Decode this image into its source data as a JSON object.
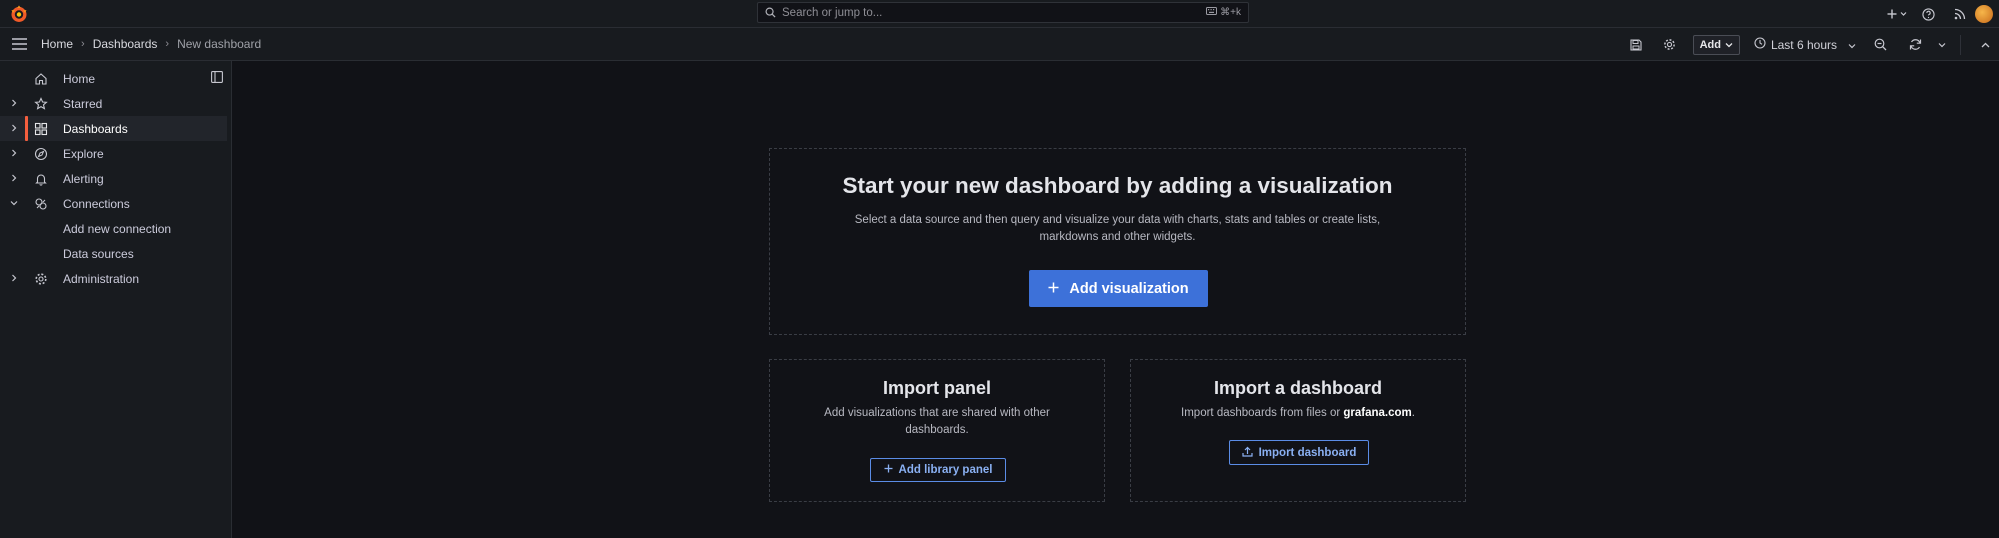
{
  "topbar": {
    "search_placeholder": "Search or jump to...",
    "search_shortcut": "⌘+k"
  },
  "breadcrumbs": [
    "Home",
    "Dashboards",
    "New dashboard"
  ],
  "toolbar": {
    "add_label": "Add",
    "time_range": "Last 6 hours"
  },
  "sidebar": {
    "items": [
      {
        "label": "Home"
      },
      {
        "label": "Starred"
      },
      {
        "label": "Dashboards"
      },
      {
        "label": "Explore"
      },
      {
        "label": "Alerting"
      },
      {
        "label": "Connections"
      },
      {
        "label": "Administration"
      }
    ],
    "connections_children": [
      "Add new connection",
      "Data sources"
    ]
  },
  "main": {
    "hero": {
      "title": "Start your new dashboard by adding a visualization",
      "description_line1": "Select a data source and then query and visualize your data with charts, stats and tables or create lists,",
      "description_line2": "markdowns and other widgets.",
      "button_label": "Add visualization"
    },
    "import_panel": {
      "title": "Import panel",
      "description_line1": "Add visualizations that are shared with other",
      "description_line2": "dashboards.",
      "button_label": "Add library panel"
    },
    "import_dashboard": {
      "title": "Import a dashboard",
      "description_prefix": "Import dashboards from files or ",
      "description_link": "grafana.com",
      "description_suffix": ".",
      "button_label": "Import dashboard"
    }
  },
  "colors": {
    "background": "#111217",
    "panel": "#181b1f",
    "primary": "#3d71d9",
    "active_indicator": "#f55f3e"
  }
}
